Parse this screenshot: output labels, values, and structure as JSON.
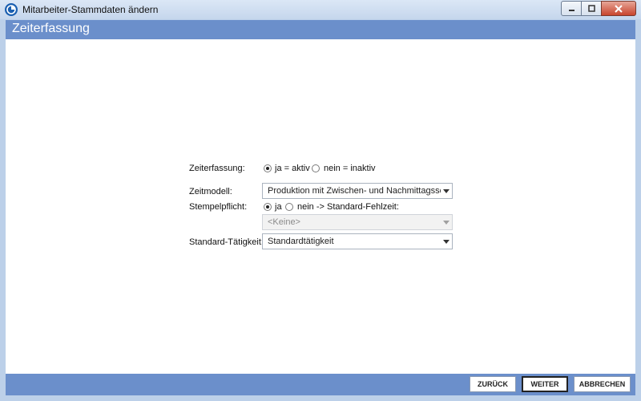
{
  "window": {
    "title": "Mitarbeiter-Stammdaten ändern",
    "icon": "app-logo-icon"
  },
  "header": {
    "title": "Zeiterfassung"
  },
  "form": {
    "zeiterfassung": {
      "label": "Zeiterfassung:",
      "option_yes": "ja = aktiv",
      "option_no": "nein = inaktiv",
      "selected": "yes"
    },
    "zeitmodell": {
      "label": "Zeitmodell:",
      "value": "Produktion mit Zwischen- und Nachmittagsschic"
    },
    "stempelpflicht": {
      "label": "Stempelpflicht:",
      "option_yes": "ja",
      "option_no": "nein -> Standard-Fehlzeit:",
      "selected": "yes",
      "fehlzeit_value": "<Keine>"
    },
    "standard_taetigkeit": {
      "label": "Standard-Tätigkeit:",
      "value": "Standardtätigkeit"
    }
  },
  "footer": {
    "back_label": "ZURÜCK",
    "next_label": "WEITER",
    "cancel_label": "ABBRECHEN"
  },
  "colors": {
    "accent": "#6b8fcb",
    "titlebar": "#c5d6ec"
  }
}
